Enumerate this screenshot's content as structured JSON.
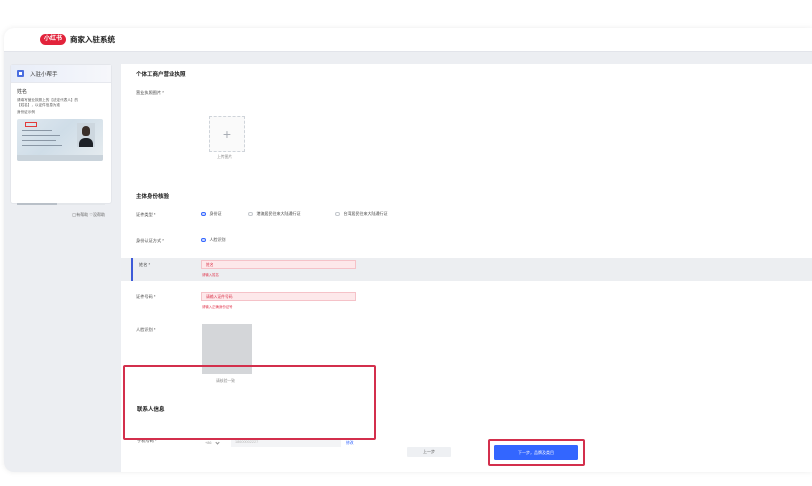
{
  "app": {
    "badge": "小红书",
    "title": "商家入驻系统"
  },
  "helper": {
    "title": "入驻小帮手",
    "field_label": "姓名",
    "desc_line1": "请填写营业执照上的【法定代表人】的",
    "desc_line2": "【姓名】，以证件信息为准",
    "sample_label": "身份证示例",
    "footer": "◯有帮助 ♡没帮助"
  },
  "form": {
    "license_section": "个体工商户营业执照",
    "license_label": "营业执照图片 *",
    "upload_caption": "上传图片",
    "identity_section": "主体身份核验",
    "doc_type_label": "证件类型 *",
    "doc_types": [
      "身份证",
      "港澳居民往来大陆通行证",
      "台湾居民往来大陆通行证"
    ],
    "verify_label": "身份认证方式 *",
    "verify_option": "人脸识别",
    "name_label": "姓名 *",
    "name_placeholder": "姓名",
    "name_error": "请输入姓名",
    "id_label": "证件号码 *",
    "id_placeholder": "请输入证件号码",
    "id_error": "请输入正确身份证号",
    "face_label": "人脸识别 *",
    "face_caption": "请核验一致",
    "contact_section": "联系人信息",
    "phone_label": "手机号码 *",
    "phone_prefix": "+86",
    "phone_value": "18600002227",
    "modify": "修改",
    "prev_button": "上一步",
    "next_button": "下一步，品牌及类目"
  },
  "colors": {
    "accent": "#3366ff",
    "error": "#e0344b",
    "brand": "#e2233b",
    "highlight": "#d32f4c"
  }
}
